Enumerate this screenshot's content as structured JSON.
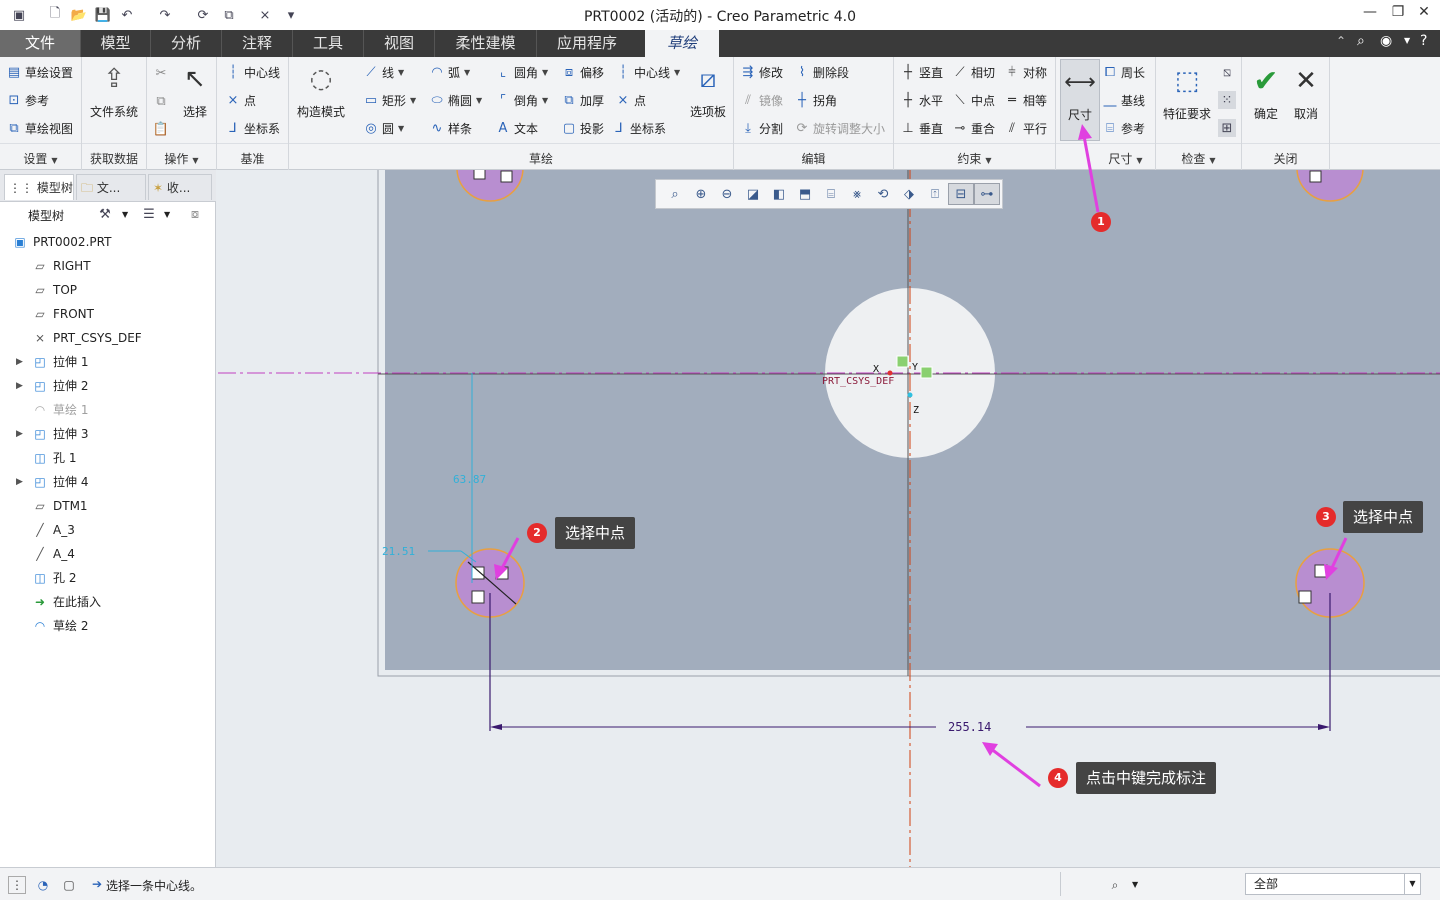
{
  "window": {
    "title": "PRT0002 (活动的) - Creo Parametric 4.0"
  },
  "tabs": [
    "文件",
    "模型",
    "分析",
    "注释",
    "工具",
    "视图",
    "柔性建模",
    "应用程序",
    "草绘"
  ],
  "ribbon": {
    "setup": {
      "label": "设置",
      "items": [
        "草绘设置",
        "参考",
        "草绘视图"
      ]
    },
    "getdata": {
      "label": "获取数据",
      "file_system": "文件系统"
    },
    "operations": {
      "label": "操作",
      "select": "选择"
    },
    "datum": {
      "label": "基准",
      "items": [
        "中心线",
        "点",
        "坐标系"
      ]
    },
    "construct_mode": "构造模式",
    "sketch": {
      "label": "草绘",
      "items": [
        "线",
        "弧",
        "圆角",
        "偏移",
        "中心线",
        "矩形",
        "椭圆",
        "倒角",
        "加厚",
        "点",
        "圆",
        "样条",
        "文本",
        "投影",
        "坐标系"
      ],
      "palette": "选项板"
    },
    "edit": {
      "label": "编辑",
      "items": [
        "修改",
        "删除段",
        "镜像",
        "拐角",
        "分割",
        "旋转调整大小"
      ]
    },
    "constrain": {
      "label": "约束",
      "items": [
        "竖直",
        "相切",
        "对称",
        "水平",
        "中点",
        "相等",
        "垂直",
        "重合",
        "平行"
      ]
    },
    "dimension": {
      "label": "尺寸",
      "big": "尺寸",
      "items": [
        "周长",
        "基线",
        "参考"
      ]
    },
    "inspect": {
      "label": "检查",
      "feature_req": "特征要求"
    },
    "close": {
      "label": "关闭",
      "ok": "确定",
      "cancel": "取消"
    }
  },
  "panel": {
    "tabs": [
      "模型树",
      "文...",
      "收..."
    ],
    "header": "模型树",
    "tree": [
      {
        "label": "PRT0002.PRT",
        "icon": "part-icon",
        "expand": false
      },
      {
        "label": "RIGHT",
        "icon": "datum-plane-icon",
        "expand": false
      },
      {
        "label": "TOP",
        "icon": "datum-plane-icon",
        "expand": false
      },
      {
        "label": "FRONT",
        "icon": "datum-plane-icon",
        "expand": false
      },
      {
        "label": "PRT_CSYS_DEF",
        "icon": "csys-icon",
        "expand": false
      },
      {
        "label": "拉伸 1",
        "icon": "extrude-icon",
        "expand": true
      },
      {
        "label": "拉伸 2",
        "icon": "extrude-icon",
        "expand": true
      },
      {
        "label": "草绘 1",
        "icon": "sketch-icon",
        "expand": false,
        "disabled": true
      },
      {
        "label": "拉伸 3",
        "icon": "extrude-icon",
        "expand": true
      },
      {
        "label": "孔 1",
        "icon": "hole-icon",
        "expand": false
      },
      {
        "label": "拉伸 4",
        "icon": "extrude-icon",
        "expand": true
      },
      {
        "label": "DTM1",
        "icon": "datum-plane-icon",
        "expand": false
      },
      {
        "label": "A_3",
        "icon": "axis-icon",
        "expand": false
      },
      {
        "label": "A_4",
        "icon": "axis-icon",
        "expand": false
      },
      {
        "label": "孔 2",
        "icon": "hole-icon",
        "expand": false
      },
      {
        "label": "在此插入",
        "icon": "insert-arrow-icon",
        "expand": false
      },
      {
        "label": "草绘 2",
        "icon": "sketch-active-icon",
        "expand": false
      }
    ]
  },
  "canvas": {
    "dims": {
      "d1": "63.87",
      "d2": "21.51",
      "d3": "255.14"
    },
    "csys_label": "PRT_CSYS_DEF",
    "axis_x": "X",
    "axis_y": "Y",
    "axis_z": "Z"
  },
  "callouts": [
    {
      "n": "1",
      "text": ""
    },
    {
      "n": "2",
      "text": "选择中点"
    },
    {
      "n": "3",
      "text": "选择中点"
    },
    {
      "n": "4",
      "text": "点击中键完成标注"
    }
  ],
  "status": {
    "message": "选择一条中心线。",
    "filter": "全部"
  },
  "colors": {
    "accent": "#2a63b8",
    "callout_badge": "#e52b2b",
    "annot_arrow": "#e040e0",
    "dim_blue": "#31b0d8",
    "sketch_purple": "#3a1a6e"
  }
}
